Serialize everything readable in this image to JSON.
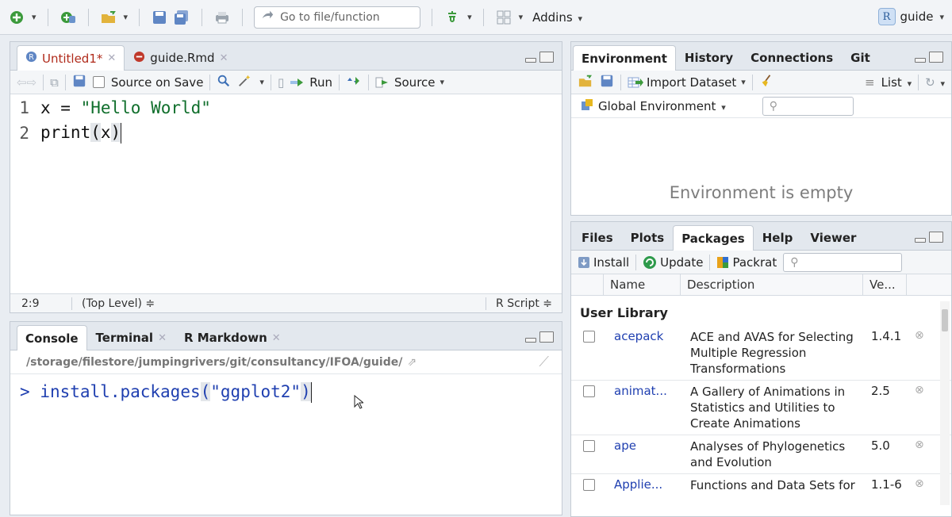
{
  "toolbar": {
    "goto_placeholder": "Go to file/function",
    "addins_label": "Addins",
    "project_label": "guide",
    "project_logo": "R"
  },
  "source": {
    "tabs": [
      {
        "label": "Untitled1*",
        "active": true
      },
      {
        "label": "guide.Rmd",
        "active": false
      }
    ],
    "toolbar": {
      "source_on_save_label": "Source on Save",
      "run_label": "Run",
      "source_label": "Source"
    },
    "lines": [
      {
        "num": "1",
        "pre": "x = ",
        "string": "\"Hello World\""
      },
      {
        "num": "2",
        "pre": "print",
        "paren_open": "(",
        "arg": "x",
        "paren_close": ")"
      }
    ],
    "status": {
      "position": "2:9",
      "scope": "(Top Level) ≑",
      "file_type": "R Script ≑"
    }
  },
  "console": {
    "tabs": [
      {
        "label": "Console",
        "active": true
      },
      {
        "label": "Terminal",
        "active": false
      },
      {
        "label": "R Markdown",
        "active": false
      }
    ],
    "path": "/storage/filestore/jumpingrivers/git/consultancy/IFOA/guide/",
    "prompt": ">",
    "command_fn": "install.packages",
    "command_arg": "\"ggplot2\""
  },
  "environment": {
    "tabs": [
      {
        "label": "Environment",
        "active": true
      },
      {
        "label": "History",
        "active": false
      },
      {
        "label": "Connections",
        "active": false
      },
      {
        "label": "Git",
        "active": false
      }
    ],
    "import_dataset_label": "Import Dataset",
    "list_label": "List",
    "scope_label": "Global Environment",
    "empty_message": "Environment is empty"
  },
  "packages": {
    "tabs": [
      {
        "label": "Files",
        "active": false
      },
      {
        "label": "Plots",
        "active": false
      },
      {
        "label": "Packages",
        "active": true
      },
      {
        "label": "Help",
        "active": false
      },
      {
        "label": "Viewer",
        "active": false
      }
    ],
    "install_label": "Install",
    "update_label": "Update",
    "packrat_label": "Packrat",
    "columns": [
      "Name",
      "Description",
      "Ve..."
    ],
    "library_title": "User Library",
    "rows": [
      {
        "name": "acepack",
        "description": "ACE and AVAS for Selecting Multiple Regression Transformations",
        "version": "1.4.1"
      },
      {
        "name": "animat...",
        "description": "A Gallery of Animations in Statistics and Utilities to Create Animations",
        "version": "2.5"
      },
      {
        "name": "ape",
        "description": "Analyses of Phylogenetics and Evolution",
        "version": "5.0"
      },
      {
        "name": "Applie...",
        "description": "Functions and Data Sets for 'Applied Predictive",
        "version": "1.1-6"
      }
    ]
  },
  "colors": {
    "accent_blue": "#1f3fb0",
    "string_green": "#0f6e2b",
    "active_tab_red": "#b02a1a"
  }
}
